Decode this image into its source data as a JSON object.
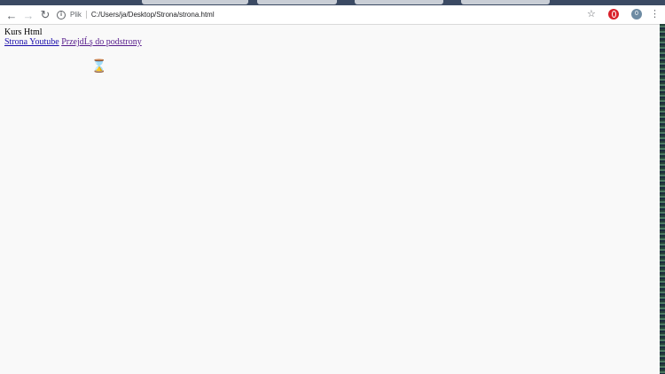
{
  "browser": {
    "address_prefix": "Plik",
    "url": "C:/Users/ja/Desktop/Strona/strona.html",
    "avatar_letter": "0"
  },
  "page": {
    "heading": "Kurs Html",
    "links": [
      {
        "label": "Strona Youtube"
      },
      {
        "label": "PrzejdĹş do podstrony"
      }
    ]
  },
  "icons": {
    "back": "back-arrow-icon",
    "forward": "forward-arrow-icon",
    "reload": "reload-icon",
    "info": "info-icon",
    "star": "star-icon",
    "opera": "opera-icon",
    "menu": "menu-icon",
    "cursor": "hourglass-cursor-icon"
  }
}
